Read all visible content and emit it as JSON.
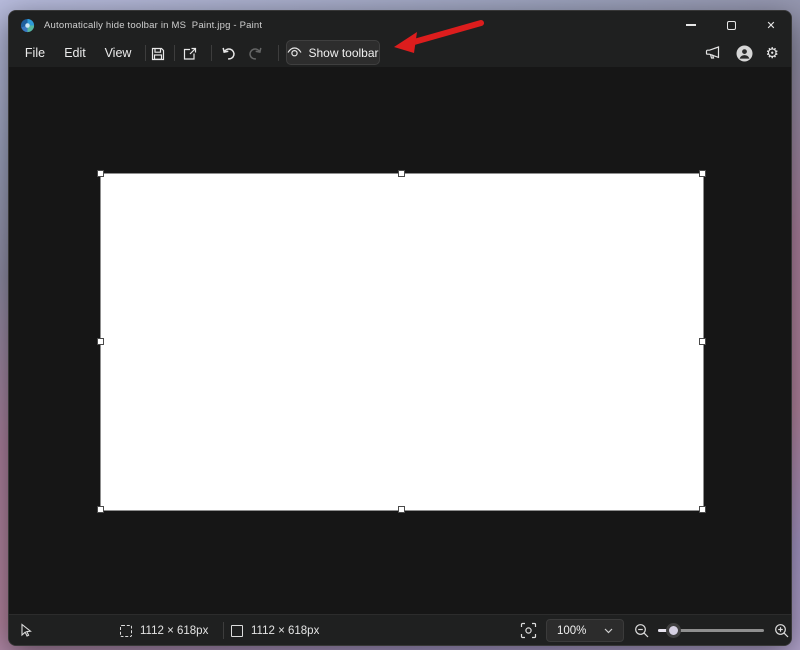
{
  "window": {
    "title": "Automatically hide toolbar in MS  Paint.jpg - Paint",
    "controls": {
      "minimize": "minimize",
      "maximize": "maximize",
      "close_glyph": "✕"
    }
  },
  "menu": {
    "items": [
      {
        "label": "File"
      },
      {
        "label": "Edit"
      },
      {
        "label": "View"
      }
    ],
    "show_toolbar_label": "Show toolbar",
    "icons": [
      "save-icon",
      "share-icon",
      "undo-icon",
      "redo-icon",
      "eye-icon",
      "megaphone-icon",
      "account-icon",
      "gear-icon"
    ],
    "gear_glyph": "⚙"
  },
  "status_bar": {
    "selection_size": "1112 × 618px",
    "canvas_size": "1112 × 618px",
    "zoom_value": "100%",
    "zoom_slider_percent": 14
  },
  "canvas": {
    "fill": "#ffffff",
    "handle_count": 8
  },
  "colors": {
    "chrome": "#1f2020",
    "workspace": "#161616",
    "button_bg": "#2d2d2d",
    "arrow_red": "#dc1d1d",
    "text": "#ececec"
  }
}
